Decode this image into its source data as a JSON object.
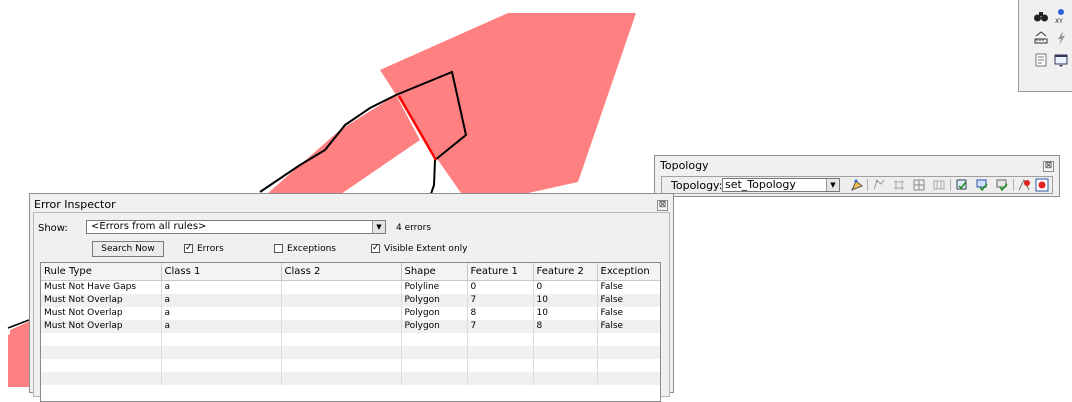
{
  "topology_toolbar": {
    "title": "Topology",
    "close_glyph": "⊠",
    "topology_label": "Topology:",
    "selected_topology": "set_Topology"
  },
  "mini_toolbar": {
    "icons": [
      "find-binoculars-icon",
      "go-to-xy-icon",
      "measure-icon",
      "lightning-icon",
      "identify-icon",
      "html-popup-icon"
    ]
  },
  "error_inspector": {
    "title": "Error Inspector",
    "close_glyph": "⊠",
    "show_label": "Show:",
    "show_value": "<Errors from all rules>",
    "error_count": "4 errors",
    "search_button": "Search Now",
    "errors_checkbox": {
      "label": "Errors",
      "checked": true
    },
    "exceptions_checkbox": {
      "label": "Exceptions",
      "checked": false
    },
    "visible_extent_checkbox": {
      "label": "Visible Extent only",
      "checked": true
    },
    "columns": [
      "Rule Type",
      "Class 1",
      "Class 2",
      "Shape",
      "Feature 1",
      "Feature 2",
      "Exception"
    ],
    "rows": [
      [
        "Must Not Have Gaps",
        "a",
        "",
        "Polyline",
        "0",
        "0",
        "False"
      ],
      [
        "Must Not Overlap",
        "a",
        "",
        "Polygon",
        "7",
        "10",
        "False"
      ],
      [
        "Must Not Overlap",
        "a",
        "",
        "Polygon",
        "8",
        "10",
        "False"
      ],
      [
        "Must Not Overlap",
        "a",
        "",
        "Polygon",
        "7",
        "8",
        "False"
      ]
    ]
  },
  "colors": {
    "polygon_fill": "#ff8080",
    "error_line": "#ff0000",
    "outline": "#000000",
    "window_bg": "#f0f0f0"
  }
}
